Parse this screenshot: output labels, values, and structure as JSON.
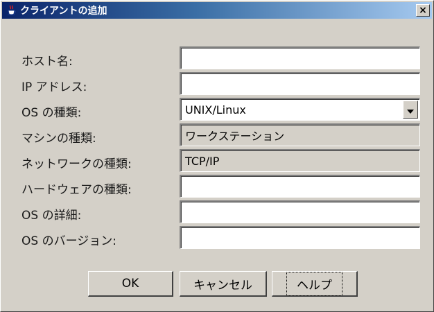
{
  "window": {
    "title": "クライアントの追加",
    "close_label": "×"
  },
  "form": {
    "fields": [
      {
        "label": "ホスト名:",
        "value": ""
      },
      {
        "label": "IP アドレス:",
        "value": ""
      },
      {
        "label": "OS の種類:",
        "value": "UNIX/Linux"
      },
      {
        "label": "マシンの種類:",
        "value": "ワークステーション"
      },
      {
        "label": "ネットワークの種類:",
        "value": "TCP/IP"
      },
      {
        "label": "ハードウェアの種類:",
        "value": ""
      },
      {
        "label": "OS の詳細:",
        "value": ""
      },
      {
        "label": "OS のバージョン:",
        "value": ""
      }
    ]
  },
  "buttons": {
    "ok": "OK",
    "cancel": "キャンセル",
    "help": "ヘルプ"
  },
  "icons": {
    "title": "java-coffee-cup-icon",
    "close": "close-icon",
    "dropdown": "chevron-down-icon"
  }
}
